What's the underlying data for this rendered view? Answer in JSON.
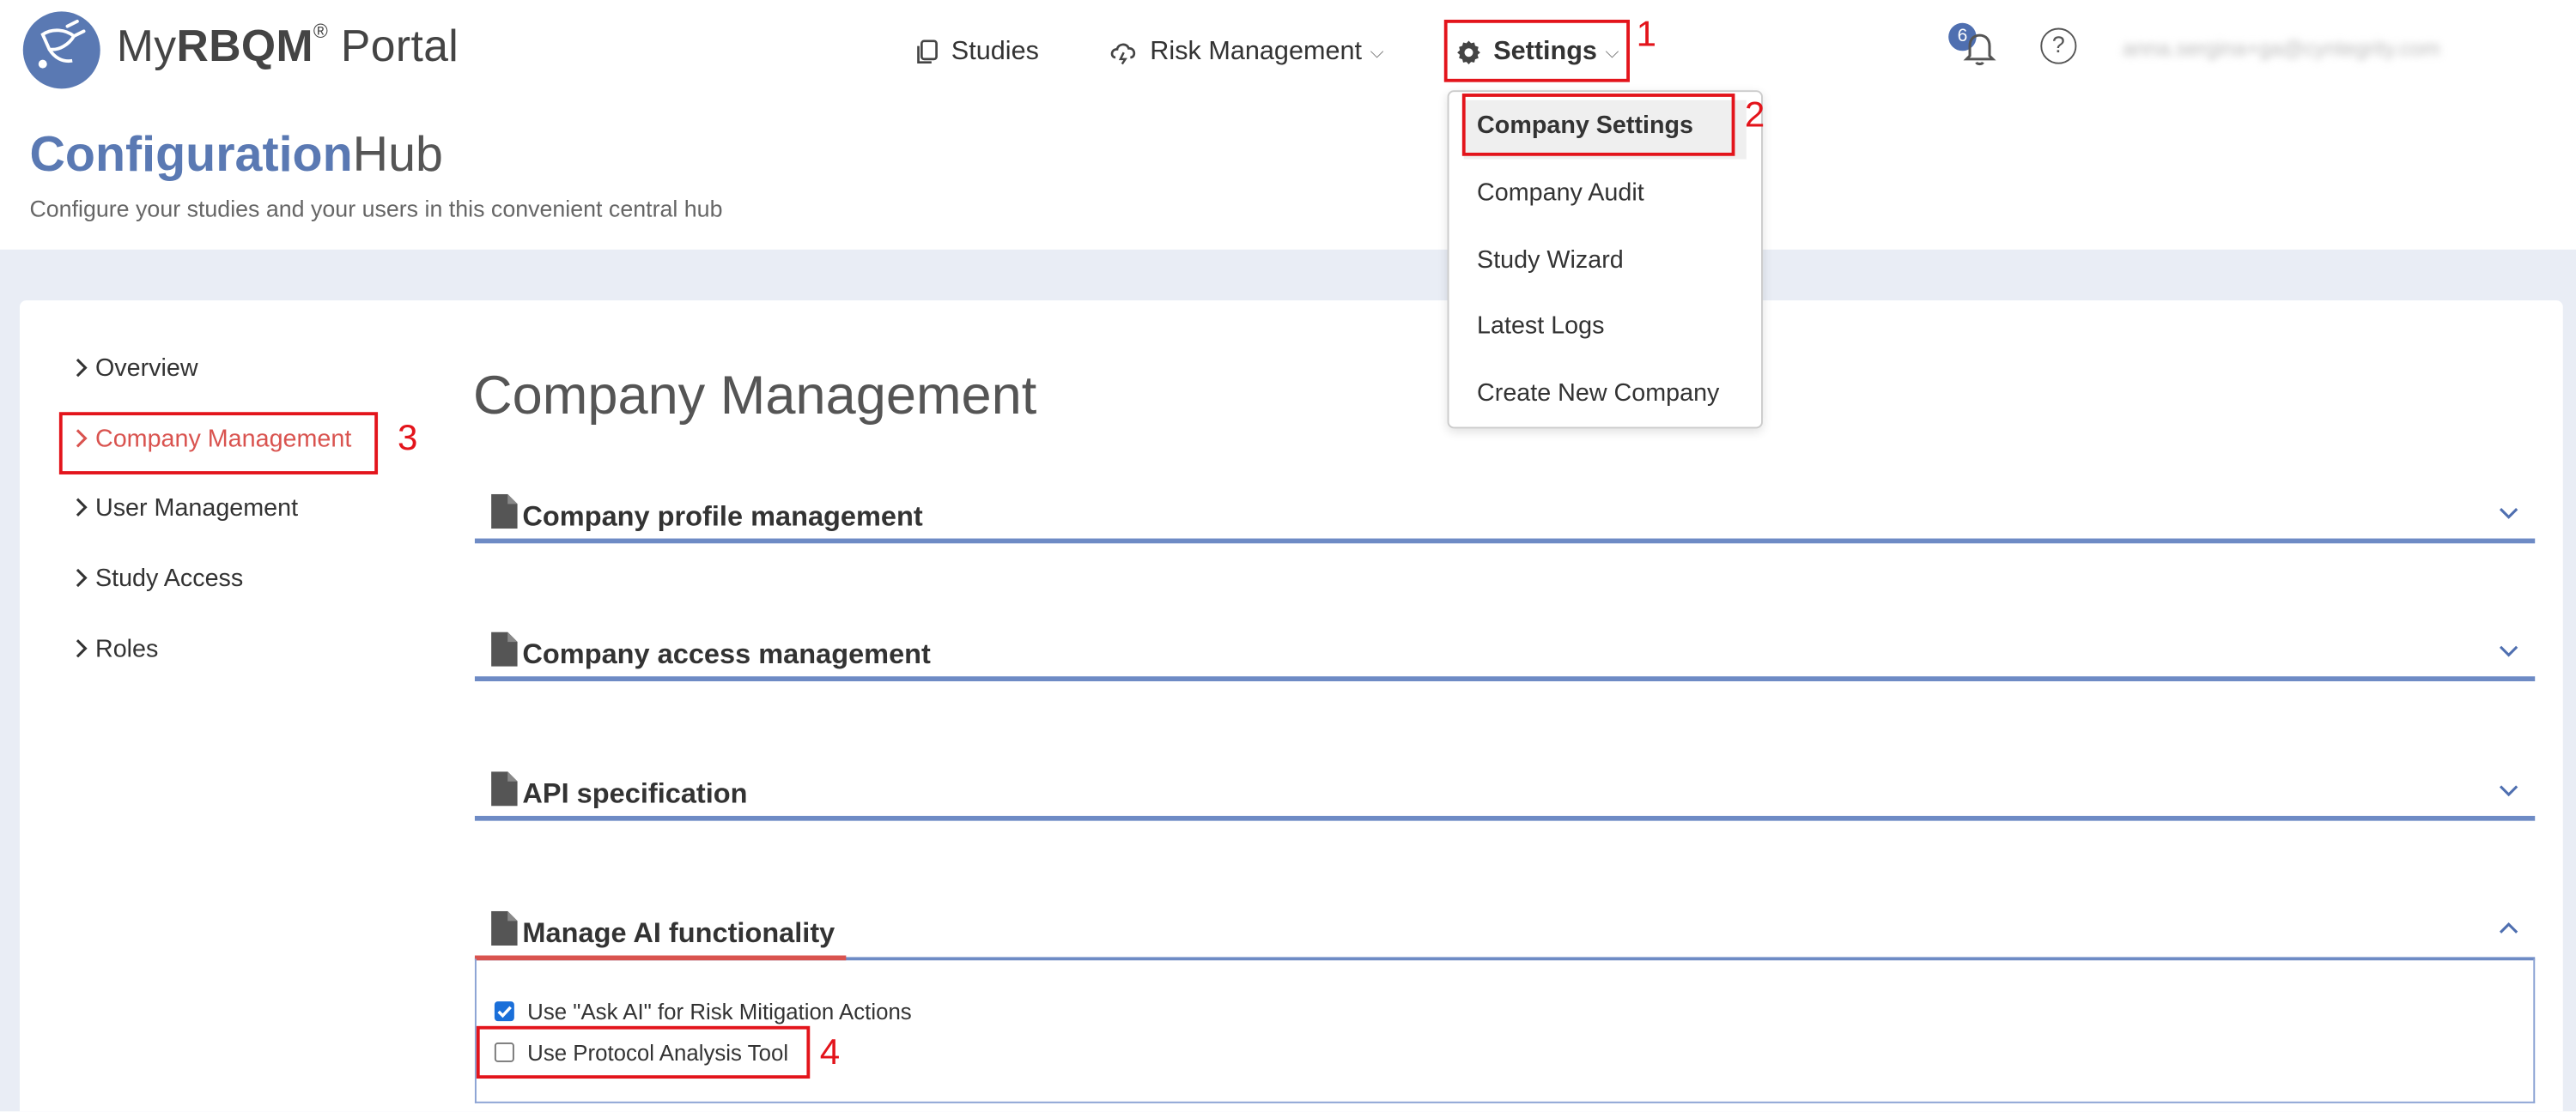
{
  "header": {
    "brand_prefix": "My",
    "brand_bold": "RBQM",
    "brand_reg": "®",
    "brand_suffix": " Portal",
    "nav": {
      "studies": "Studies",
      "risk_management": "Risk Management",
      "settings": "Settings"
    },
    "notifications_count": "6",
    "help_glyph": "?",
    "user_email": "anna.sergina+ga@cyntegrity.com"
  },
  "hub": {
    "title_strong": "Configuration",
    "title_light": "Hub",
    "subtitle": "Configure your studies and your users in this convenient central hub"
  },
  "sidebar": {
    "items": [
      {
        "label": "Overview"
      },
      {
        "label": "Company Management",
        "active": true
      },
      {
        "label": "User Management"
      },
      {
        "label": "Study Access"
      },
      {
        "label": "Roles"
      }
    ]
  },
  "main": {
    "title": "Company Management",
    "sections": [
      {
        "title": "Company profile management",
        "expanded": false
      },
      {
        "title": "Company access management",
        "expanded": false
      },
      {
        "title": "API specification",
        "expanded": false
      },
      {
        "title": "Manage AI functionality",
        "expanded": true
      }
    ],
    "ai_options": [
      {
        "label": "Use \"Ask AI\" for Risk Mitigation Actions",
        "checked": true
      },
      {
        "label": "Use Protocol Analysis Tool",
        "checked": false
      }
    ]
  },
  "settings_menu": {
    "items": [
      {
        "label": "Company Settings",
        "active": true
      },
      {
        "label": "Company Audit"
      },
      {
        "label": "Study Wizard"
      },
      {
        "label": "Latest Logs"
      },
      {
        "label": "Create New Company"
      }
    ]
  },
  "annotations": {
    "step1": "1",
    "step2": "2",
    "step3": "3",
    "step4": "4",
    "color": "#e3141b"
  },
  "colors": {
    "brand_blue": "#5a79b3",
    "accordion_line": "#6e8bc5",
    "active_red": "#d9534f",
    "band": "#e9edf5"
  }
}
